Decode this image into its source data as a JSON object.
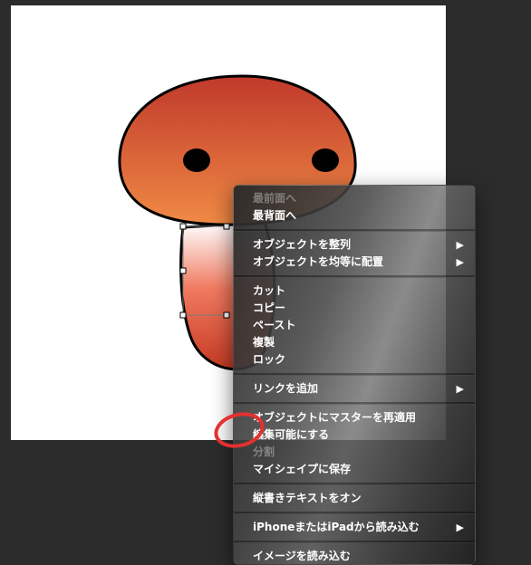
{
  "colors": {
    "app_background": "#2c2c2c",
    "canvas": "#ffffff",
    "cap_top": "#c0392b",
    "cap_bottom": "#f08a45",
    "stem_top": "#ffffff",
    "stem_bottom": "#c63a22",
    "annotation": "#e3312f"
  },
  "context_menu": {
    "bring_to_front": "最前面へ",
    "send_to_back": "最背面へ",
    "align_objects": "オブジェクトを整列",
    "distribute_objects": "オブジェクトを均等に配置",
    "cut": "カット",
    "copy": "コピー",
    "paste": "ペースト",
    "duplicate": "複製",
    "lock": "ロック",
    "add_link": "リンクを追加",
    "apply_master": "オブジェクトにマスターを再適用",
    "make_editable": "編集可能にする",
    "split": "分割",
    "save_to_my_shapes": "マイシェイプに保存",
    "vertical_text_on": "縦書きテキストをオン",
    "import_from_iphone_ipad": "iPhoneまたはiPadから読み込む",
    "import_image": "イメージを読み込む",
    "submenu_arrow": "▶"
  }
}
